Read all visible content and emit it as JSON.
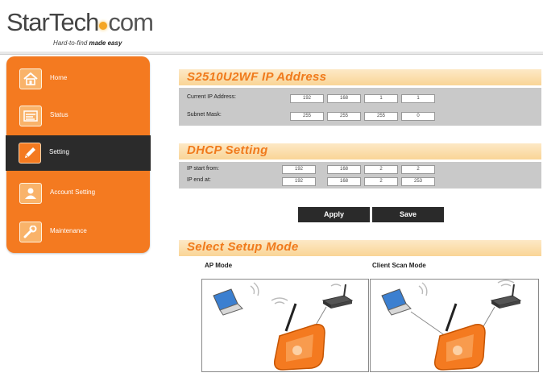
{
  "brand": {
    "logo_part1": "StarTech",
    "logo_part2": "com",
    "tagline": "Hard-to-find",
    "tagline_emph": "made easy"
  },
  "sidebar": {
    "items": [
      {
        "label": "Home",
        "icon": "home-icon"
      },
      {
        "label": "Status",
        "icon": "status-icon"
      },
      {
        "label": "Setting",
        "icon": "pencil-icon",
        "active": true
      },
      {
        "label": "Account Setting",
        "icon": "user-icon"
      },
      {
        "label": "Maintenance",
        "icon": "wrench-icon"
      }
    ]
  },
  "ip_section": {
    "title": "S2510U2WF IP Address",
    "current_ip_label": "Current IP Address:",
    "current_ip": [
      "192",
      "168",
      "1",
      "1"
    ],
    "subnet_label": "Subnet Mask:",
    "subnet": [
      "255",
      "255",
      "255",
      "0"
    ]
  },
  "dhcp_section": {
    "title": "DHCP Setting",
    "start_label": "IP start from:",
    "start": [
      "192",
      "168",
      "2",
      "2"
    ],
    "end_label": "IP end at:",
    "end": [
      "192",
      "168",
      "2",
      "253"
    ]
  },
  "buttons": {
    "apply": "Apply",
    "save": "Save"
  },
  "setup_mode": {
    "title": "Select Setup Mode",
    "ap_mode_label": "AP Mode",
    "client_mode_label": "Client Scan Mode"
  },
  "colors": {
    "accent": "#f47a20",
    "section_title": "#f07a1c",
    "active_nav": "#2b2b2b"
  }
}
